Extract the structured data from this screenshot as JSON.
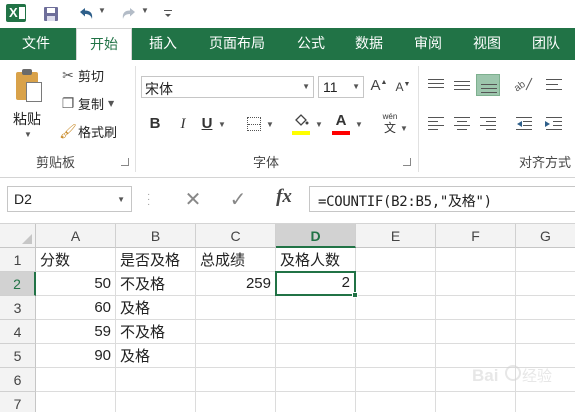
{
  "quick_access": {
    "save_icon": "save-icon",
    "undo_icon": "undo-icon",
    "redo_icon": "redo-icon"
  },
  "tabs": {
    "file": "文件",
    "home": "开始",
    "insert": "插入",
    "page_layout": "页面布局",
    "formulas": "公式",
    "data": "数据",
    "review": "审阅",
    "view": "视图",
    "team": "团队"
  },
  "clipboard": {
    "paste": "粘贴",
    "cut": "剪切",
    "copy": "复制",
    "format_painter": "格式刷",
    "group_label": "剪贴板"
  },
  "font": {
    "name": "宋体",
    "size": "11",
    "grow": "A",
    "shrink": "A",
    "bold": "B",
    "italic": "I",
    "underline": "U",
    "font_color_glyph": "A",
    "phonetic_top": "wén",
    "phonetic_char": "文",
    "fill_color": "#ffff00",
    "font_color": "#ff0000",
    "group_label": "字体"
  },
  "alignment": {
    "group_label": "对齐方式"
  },
  "formula_bar": {
    "name_box": "D2",
    "cancel": "✕",
    "enter": "✓",
    "fx": "fx",
    "formula": "=COUNTIF(B2:B5,\"及格\")"
  },
  "sheet": {
    "columns": [
      "A",
      "B",
      "C",
      "D",
      "E",
      "F",
      "G"
    ],
    "rows": [
      "1",
      "2",
      "3",
      "4",
      "5",
      "6",
      "7"
    ],
    "selected_cell": "D2",
    "cells": {
      "A1": "分数",
      "B1": "是否及格",
      "C1": "总成绩",
      "D1": "及格人数",
      "A2": "50",
      "B2": "不及格",
      "C2": "259",
      "D2": "2",
      "A3": "60",
      "B3": "及格",
      "A4": "59",
      "B4": "不及格",
      "A5": "90",
      "B5": "及格"
    }
  },
  "accent_color": "#217346"
}
